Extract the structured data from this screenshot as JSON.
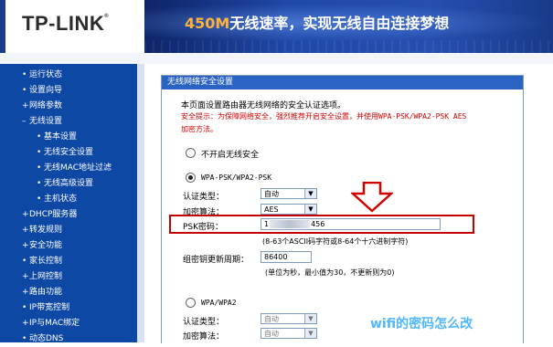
{
  "brand": {
    "logo_text": "TP-LINK",
    "logo_mark": "®",
    "slogan_highlight": "450M",
    "slogan_rest": "无线速率，实现无线自由连接梦想"
  },
  "sidebar": {
    "items": [
      {
        "label": "运行状态",
        "bullet": "•"
      },
      {
        "label": "设置向导",
        "bullet": "•"
      },
      {
        "label": "网络参数",
        "bullet": "+"
      },
      {
        "label": "无线设置",
        "bullet": "–"
      },
      {
        "label": "基本设置",
        "bullet": "•"
      },
      {
        "label": "无线安全设置",
        "bullet": "•"
      },
      {
        "label": "无线MAC地址过滤",
        "bullet": "•"
      },
      {
        "label": "无线高级设置",
        "bullet": "•"
      },
      {
        "label": "主机状态",
        "bullet": "•"
      },
      {
        "label": "DHCP服务器",
        "bullet": "+"
      },
      {
        "label": "转发规则",
        "bullet": "+"
      },
      {
        "label": "安全功能",
        "bullet": "+"
      },
      {
        "label": "家长控制",
        "bullet": "•"
      },
      {
        "label": "上网控制",
        "bullet": "+"
      },
      {
        "label": "路由功能",
        "bullet": "+"
      },
      {
        "label": "IP带宽控制",
        "bullet": "•"
      },
      {
        "label": "IP与MAC绑定",
        "bullet": "+"
      },
      {
        "label": "动态DNS",
        "bullet": "•"
      }
    ]
  },
  "panel": {
    "title": "无线网络安全设置",
    "intro": "本页面设置路由器无线网络的安全认证选项。",
    "warning_line1": "安全提示：为保障网络安全，强烈推荐开启安全设置，并使用WPA-PSK/WPA2-PSK AES",
    "warning_line2": "加密方法。",
    "opt_none": "不开启无线安全",
    "opt_psk": "WPA-PSK/WPA2-PSK",
    "auth_label": "认证类型：",
    "auth_value": "自动",
    "enc_label": "加密算法：",
    "enc_value": "AES",
    "psk_label": "PSK密码：",
    "psk_prefix": "1",
    "psk_suffix": "456",
    "psk_hint": "(8-63个ASCII码字符或8-64个十六进制字符)",
    "renew_label": "组密钥更新周期：",
    "renew_value": "86400",
    "renew_hint": "(单位为秒，最小值为30，不更新则为0)",
    "opt_wpa": "WPA/WPA2",
    "auth2_label": "认证类型：",
    "auth2_value": "自动",
    "enc2_label": "加密算法：",
    "enc2_value": "自动"
  },
  "caption": "wifi的密码怎么改",
  "colors": {
    "sidebar": "#0e48a5",
    "banner": "#1c3d8e",
    "highlight_box": "#c40000",
    "caption": "#4fb6ff",
    "warning": "#d60000"
  }
}
